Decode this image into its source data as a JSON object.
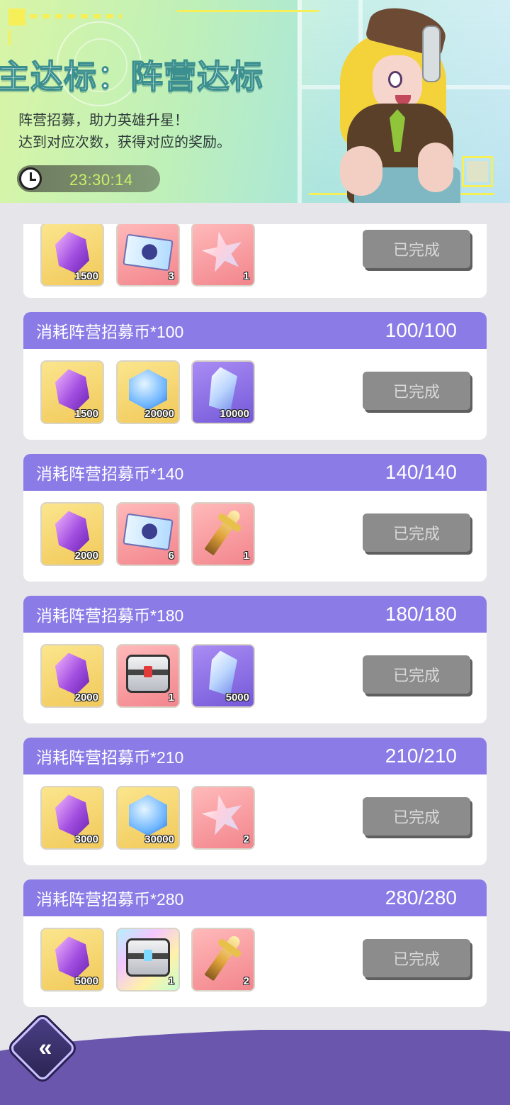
{
  "banner": {
    "title": "主达标：阵营达标",
    "desc_line1": "阵营招募，助力英雄升星！",
    "desc_line2": "达到对应次数，获得对应的奖励。",
    "timer": "23:30:14"
  },
  "colors": {
    "header_purple": "#8a7be6",
    "button_gray": "#8c8c8c",
    "timer_green": "#c8f06a",
    "footer_purple": "#6a57ad"
  },
  "tasks": [
    {
      "title": "",
      "progress": "",
      "button": "已完成",
      "rewards": [
        {
          "icon": "purple-gem-icon",
          "qty": "1500"
        },
        {
          "icon": "recruit-ticket-icon",
          "qty": "3"
        },
        {
          "icon": "star-shard-icon",
          "qty": "1"
        }
      ]
    },
    {
      "title": "消耗阵营招募币*100",
      "progress": "100/100",
      "button": "已完成",
      "rewards": [
        {
          "icon": "purple-gem-icon",
          "qty": "1500"
        },
        {
          "icon": "blue-diamond-icon",
          "qty": "20000"
        },
        {
          "icon": "crystal-icon",
          "qty": "10000"
        }
      ]
    },
    {
      "title": "消耗阵营招募币*140",
      "progress": "140/140",
      "button": "已完成",
      "rewards": [
        {
          "icon": "purple-gem-icon",
          "qty": "2000"
        },
        {
          "icon": "recruit-ticket-icon",
          "qty": "6"
        },
        {
          "icon": "weapon-icon",
          "qty": "1"
        }
      ]
    },
    {
      "title": "消耗阵营招募币*180",
      "progress": "180/180",
      "button": "已完成",
      "rewards": [
        {
          "icon": "purple-gem-icon",
          "qty": "2000"
        },
        {
          "icon": "chest-icon",
          "qty": "1"
        },
        {
          "icon": "crystal-icon",
          "qty": "5000"
        }
      ]
    },
    {
      "title": "消耗阵营招募币*210",
      "progress": "210/210",
      "button": "已完成",
      "rewards": [
        {
          "icon": "purple-gem-icon",
          "qty": "3000"
        },
        {
          "icon": "blue-diamond-icon",
          "qty": "30000"
        },
        {
          "icon": "star-shard-icon",
          "qty": "2"
        }
      ]
    },
    {
      "title": "消耗阵营招募币*280",
      "progress": "280/280",
      "button": "已完成",
      "rewards": [
        {
          "icon": "purple-gem-icon",
          "qty": "5000"
        },
        {
          "icon": "holo-chest-icon",
          "qty": "1"
        },
        {
          "icon": "weapon-icon",
          "qty": "2"
        }
      ]
    }
  ],
  "footer": {
    "back_label": "«"
  }
}
